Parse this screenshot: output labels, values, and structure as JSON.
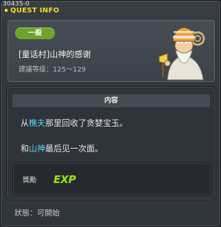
{
  "window": {
    "id_code": "30435-0",
    "title": "QUEST INFO"
  },
  "quest": {
    "category": "一般",
    "name": "[童话村]山神的感谢",
    "level_range": "建議等级：125～129"
  },
  "content": {
    "header": "内容",
    "line1": {
      "pre": "从",
      "highlight": "樵夫",
      "post": "那里回收了贪婪宝玉。"
    },
    "line2": {
      "pre": "和",
      "highlight": "山神",
      "post": "最后见一次面。"
    }
  },
  "reward": {
    "label": "獎勵",
    "items": [
      {
        "icon": "exp-icon",
        "text": "EXP"
      }
    ]
  },
  "status": "狀態：可開始",
  "colors": {
    "title": "#f0e020",
    "category_pill": "#6fa32b",
    "highlight": "#5fd4f0",
    "exp_green": "#9de020"
  }
}
